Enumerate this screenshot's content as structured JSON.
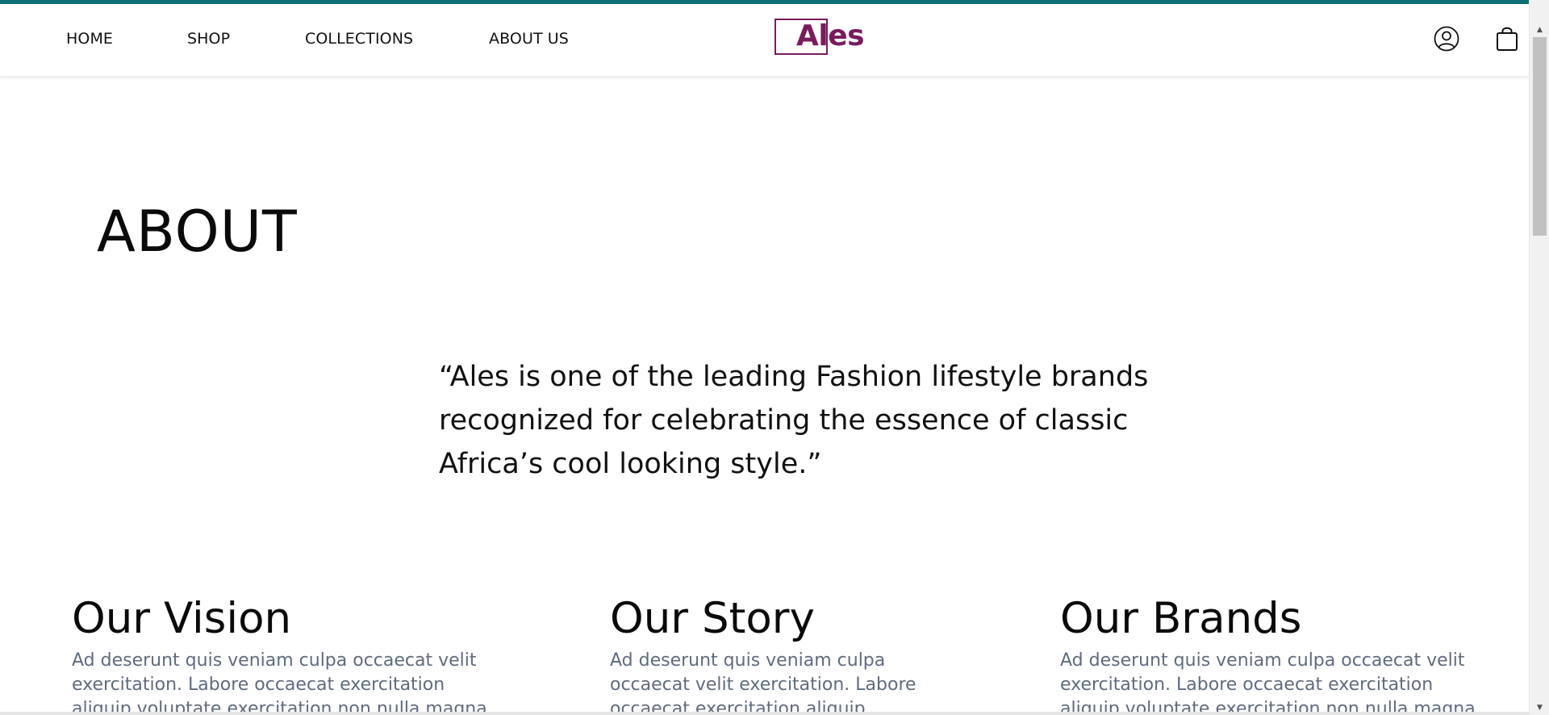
{
  "colors": {
    "accent_bar": "#0f6e73",
    "brand": "#7a1b5e",
    "body_text": "#5f6b80",
    "heading_text": "#0a0a0a"
  },
  "header": {
    "nav": [
      {
        "label": "HOME"
      },
      {
        "label": "SHOP"
      },
      {
        "label": "COLLECTIONS"
      },
      {
        "label": "ABOUT US"
      }
    ],
    "logo_text": "Ales",
    "icons": {
      "account": "user-circle-icon",
      "cart": "shopping-bag-icon"
    }
  },
  "main": {
    "page_title": "ABOUT",
    "quote": "“Ales is one of the leading Fashion lifestyle brands recognized for celebrating the essence of classic Africa’s cool looking style.”",
    "columns": [
      {
        "heading": "Our Vision",
        "text": "Ad deserunt quis veniam culpa occaecat velit exercitation. Labore occaecat exercitation aliquip voluptate exercitation non nulla magna"
      },
      {
        "heading": "Our Story",
        "text": "Ad deserunt quis veniam culpa occaecat velit exercitation. Labore occaecat exercitation aliquip"
      },
      {
        "heading": "Our Brands",
        "text": "Ad deserunt quis veniam culpa occaecat velit exercitation. Labore occaecat exercitation aliquip voluptate exercitation non nulla magna"
      }
    ]
  }
}
